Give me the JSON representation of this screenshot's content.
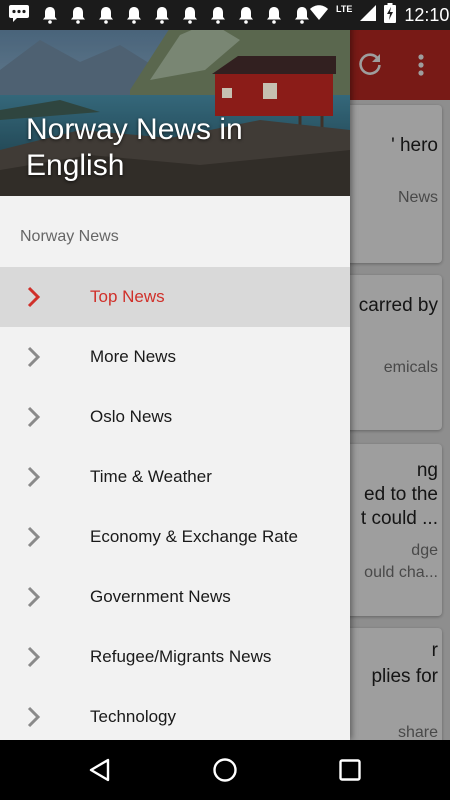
{
  "status_bar": {
    "time": "12:10",
    "network": "LTE",
    "icons": [
      "message-icon",
      "bell-icon",
      "bell-icon",
      "bell-icon",
      "bell-icon",
      "bell-icon",
      "bell-icon",
      "bell-icon",
      "bell-icon",
      "bell-icon",
      "bell-icon",
      "wifi-icon",
      "signal-icon",
      "battery-charging-icon"
    ]
  },
  "drawer": {
    "title": "Norway News in English",
    "section_label": "Norway News",
    "items": [
      {
        "label": "Top News",
        "icon": "chevron-right-icon",
        "active": true
      },
      {
        "label": "More News",
        "icon": "chevron-right-icon",
        "active": false
      },
      {
        "label": "Oslo News",
        "icon": "chevron-right-icon",
        "active": false
      },
      {
        "label": "Time & Weather",
        "icon": "chevron-right-icon",
        "active": false
      },
      {
        "label": "Economy & Exchange Rate",
        "icon": "chevron-right-icon",
        "active": false
      },
      {
        "label": "Government News",
        "icon": "chevron-right-icon",
        "active": false
      },
      {
        "label": "Refugee/Migrants News",
        "icon": "chevron-right-icon",
        "active": false
      },
      {
        "label": "Technology",
        "icon": "chevron-right-icon",
        "active": false
      }
    ]
  },
  "background": {
    "toolbar_icons": [
      "refresh-icon",
      "more-vert-icon"
    ],
    "cards": [
      {
        "lines": [
          "' hero",
          "News"
        ]
      },
      {
        "lines": [
          "carred by",
          "emicals"
        ]
      },
      {
        "lines": [
          "ng",
          "ed to the",
          "t could ...",
          "dge",
          "ould cha..."
        ]
      },
      {
        "lines": [
          "r",
          "plies for",
          "share"
        ]
      }
    ]
  },
  "nav_bar": {
    "buttons": [
      "back-icon",
      "home-icon",
      "recents-icon"
    ]
  },
  "colors": {
    "accent": "#d0302a",
    "toolbar": "#c22a24",
    "active_item_bg": "#d9d9d9"
  }
}
